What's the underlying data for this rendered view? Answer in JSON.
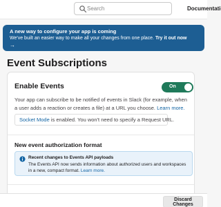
{
  "header": {
    "search": {
      "placeholder": "Search",
      "value": ""
    },
    "docs_label": "Documentation"
  },
  "banner": {
    "title": "A new way to configure your app is coming",
    "body": "We've built an easier way to make all your changes from one place.",
    "cta": "Try it out now",
    "arrow": "→"
  },
  "page": {
    "title": "Event Subscriptions"
  },
  "enable_events": {
    "title": "Enable Events",
    "toggle_label": "On",
    "toggle_on": true,
    "description": "Your app can subscribe to be notified of events in Slack (for example, when a user adds a reaction or creates a file) at a URL you choose.",
    "learn_more": "Learn more.",
    "socket_mode_link": "Socket Mode",
    "socket_mode_text": " is enabled. You won't need to specify a Request URL."
  },
  "authorization": {
    "title": "New event authorization format",
    "info_title": "Recent changes to Events API payloads",
    "info_body": "The Events API now sends information about authorized users and workspaces in a new, compact format.",
    "info_link": "Learn more."
  },
  "footer": {
    "discard_label": "Discard Changes"
  },
  "colors": {
    "banner": "#1d5e93",
    "toggle_on": "#1f7a5a",
    "link": "#1264a3",
    "info_bg": "#e9f2fa"
  }
}
